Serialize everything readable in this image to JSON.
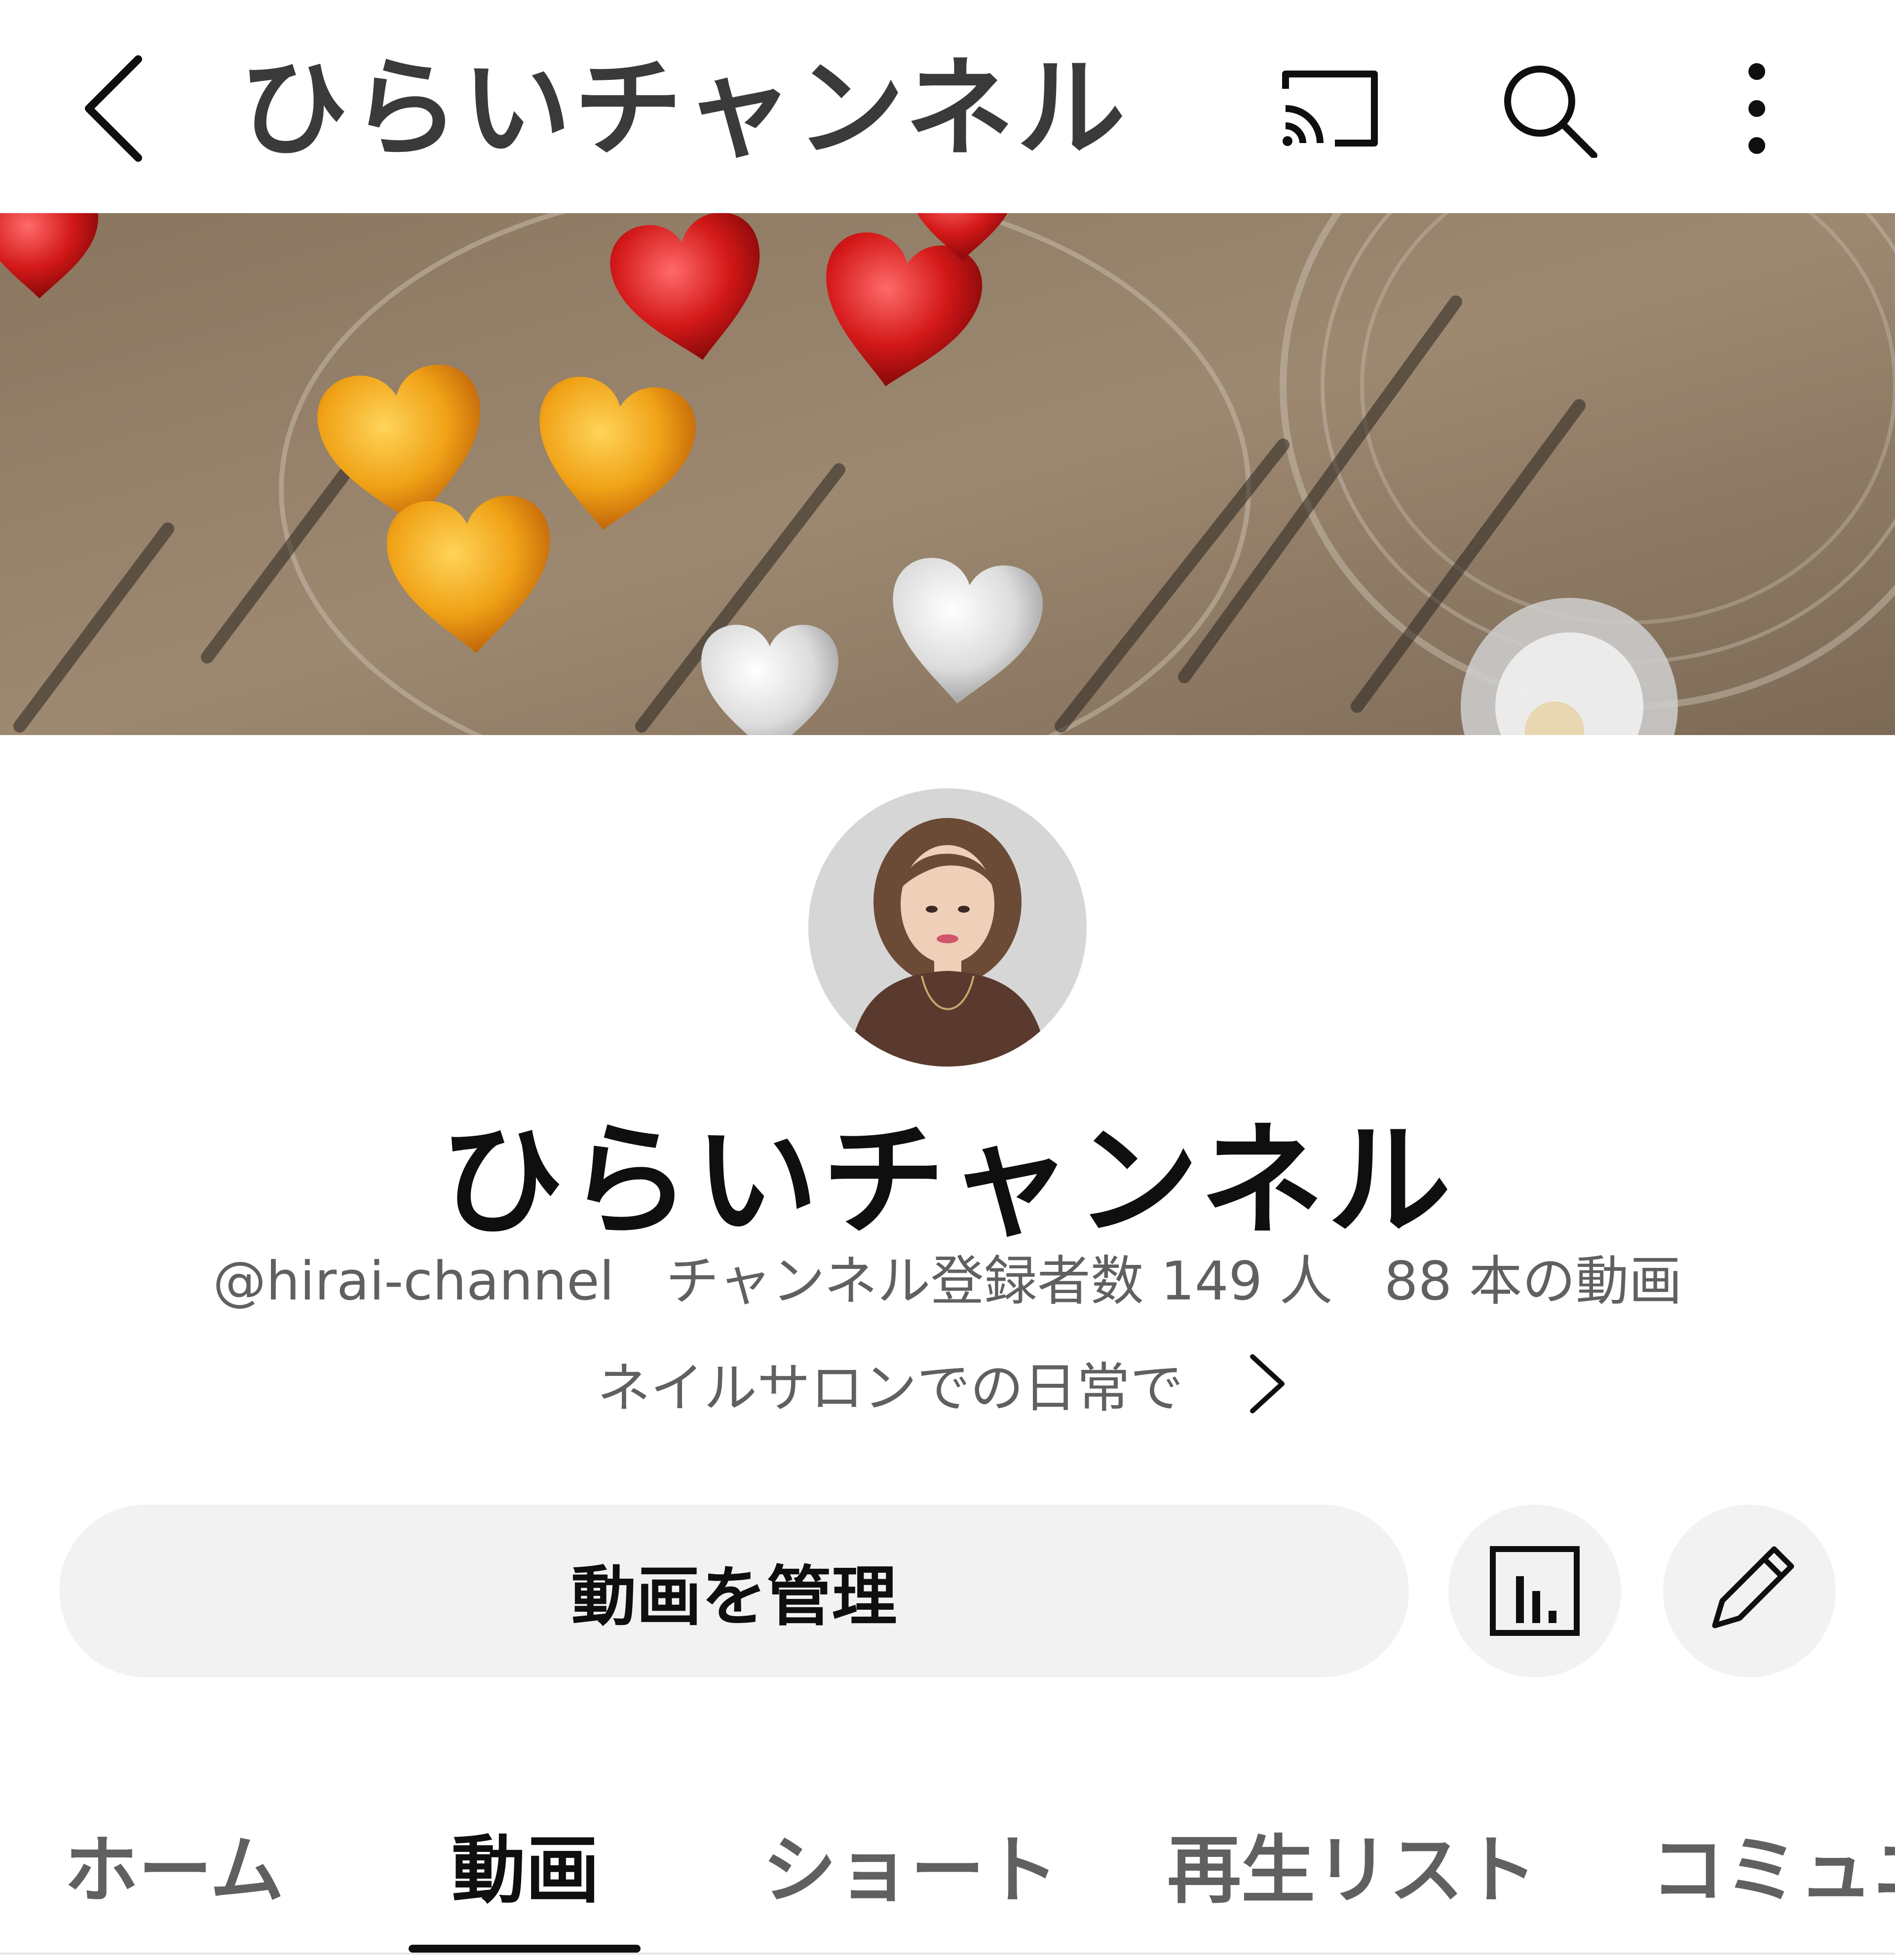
{
  "header": {
    "title": "ひらいチャンネル",
    "icons": [
      "back-icon",
      "cast-icon",
      "search-icon",
      "more-vertical-icon"
    ]
  },
  "channel": {
    "name": "ひらいチャンネル",
    "handle": "@hirai-channel",
    "subscribers": "チャンネル登録者数 149 人",
    "videos": "88 本の動画",
    "description": "ネイルサロンでの日常で"
  },
  "actions": {
    "manage_videos": "動画を管理",
    "analytics_icon": "analytics-icon",
    "edit_icon": "pencil-icon"
  },
  "tabs": [
    {
      "label": "ホーム",
      "active": false
    },
    {
      "label": "動画",
      "active": true
    },
    {
      "label": "ショート",
      "active": false
    },
    {
      "label": "再生リスト",
      "active": false
    },
    {
      "label": "コミュニ",
      "active": false
    }
  ],
  "colors": {
    "primary_text": "#0f0f0f",
    "secondary_text": "#606060",
    "button_bg": "#f2f2f2"
  }
}
